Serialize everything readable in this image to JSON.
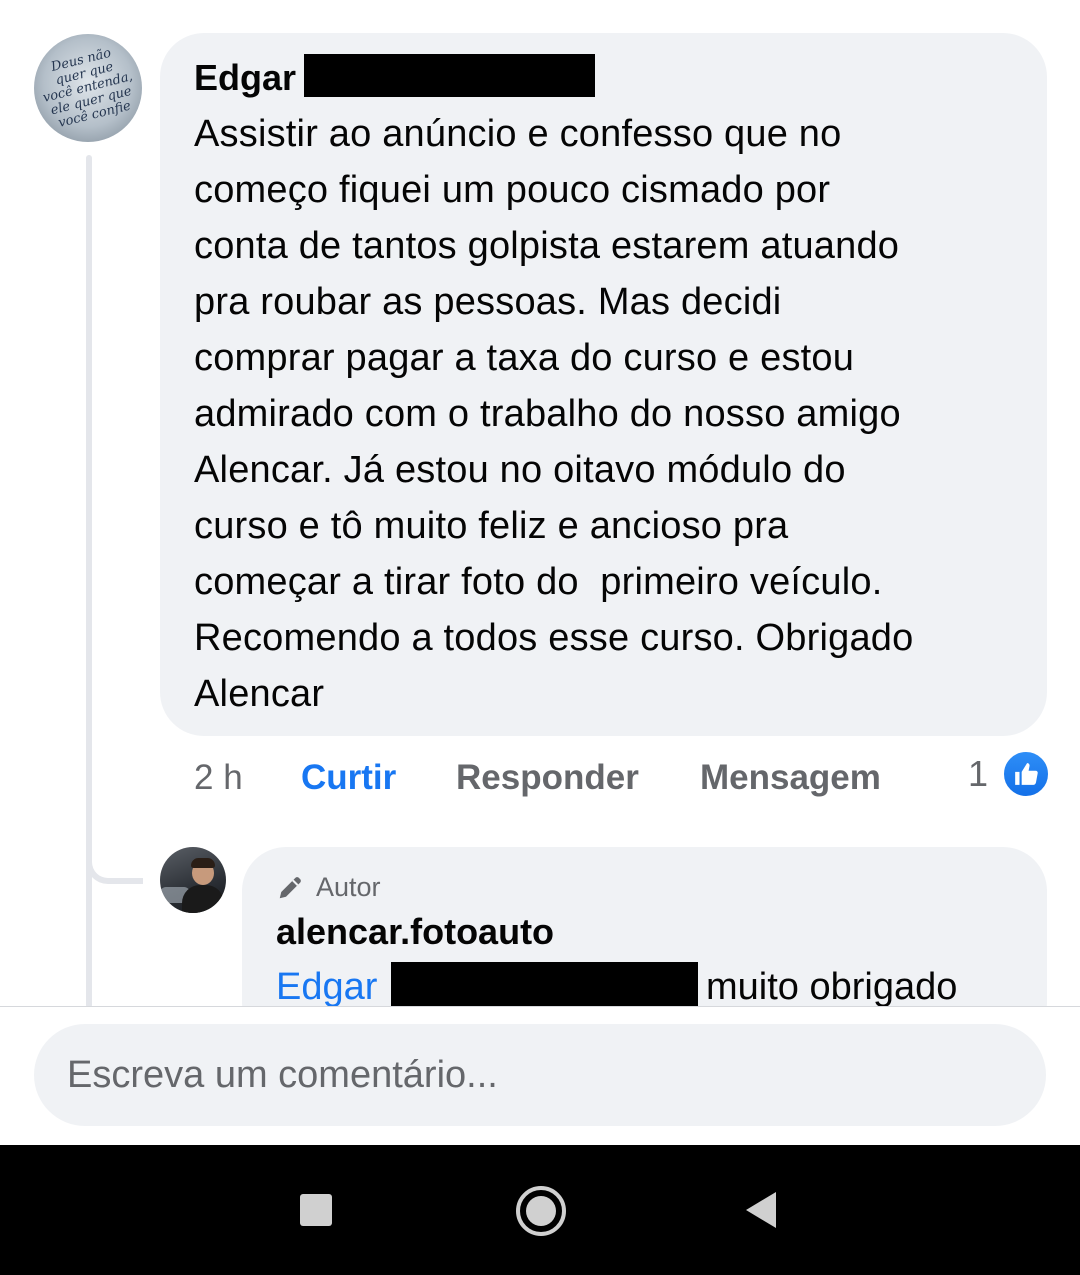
{
  "comment": {
    "author_visible": "Edgar",
    "avatar_text": "Deus não quer que você entenda, ele quer que você confie",
    "text_lines": [
      "Assistir ao anúncio e confesso que no",
      "começo fiquei um pouco cismado por",
      "conta de tantos golpista estarem atuando",
      "pra roubar as pessoas. Mas decidi",
      "comprar pagar a taxa do curso e estou",
      "admirado com o trabalho do nosso amigo",
      "Alencar. Já estou no oitavo módulo do",
      "curso e tô muito feliz e ancioso pra",
      "começar a tirar foto do  primeiro veículo.",
      "Recomendo a todos esse curso. Obrigado",
      "Alencar"
    ],
    "time": "2 h",
    "like_label": "Curtir",
    "reply_label": "Responder",
    "message_label": "Mensagem",
    "like_count": "1",
    "like_icon": "thumbs-up-icon"
  },
  "reply": {
    "badge_icon": "pencil-icon",
    "badge_label": "Autor",
    "author": "alencar.fotoauto",
    "mention": "Edgar",
    "text_visible": "muito obrigado"
  },
  "composer": {
    "placeholder": "Escreva um comentário..."
  },
  "navigation": {
    "recents_icon": "square-icon",
    "home_icon": "circle-icon",
    "back_icon": "triangle-back-icon"
  },
  "colors": {
    "accent": "#1877f2",
    "bubble": "#f0f2f5",
    "secondary_text": "#65676b"
  }
}
